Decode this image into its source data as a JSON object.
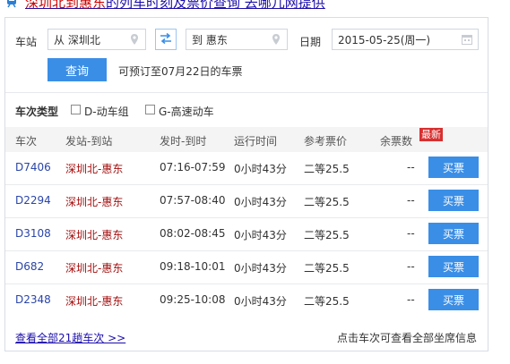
{
  "title": {
    "prefix": "",
    "highlight1": "深圳北到惠东",
    "middle": "的列车时刻及票价查询",
    "suffix": " 去哪儿网提供"
  },
  "search": {
    "station_label": "车站",
    "from_value": "从 深圳北",
    "to_value": "到 惠东",
    "date_label": "日期",
    "date_value": "2015-05-25(周一)",
    "query_button": "查询",
    "note": "可预订至07月22日的车票"
  },
  "filters": {
    "label": "车次类型",
    "options": [
      {
        "label": "D-动车组",
        "checked": false
      },
      {
        "label": "G-高速动车",
        "checked": false
      }
    ]
  },
  "table": {
    "headers": [
      "车次",
      "发站-到站",
      "发时-到时",
      "运行时间",
      "参考票价",
      "余票数"
    ],
    "new_badge": "最新",
    "rows": [
      {
        "train": "D7406",
        "route": "深圳北-惠东",
        "time": "07:16-07:59",
        "duration": "0小时43分",
        "price": "二等25.5",
        "remaining": "--",
        "buy": "买票"
      },
      {
        "train": "D2294",
        "route": "深圳北-惠东",
        "time": "07:57-08:40",
        "duration": "0小时43分",
        "price": "二等25.5",
        "remaining": "--",
        "buy": "买票"
      },
      {
        "train": "D3108",
        "route": "深圳北-惠东",
        "time": "08:02-08:45",
        "duration": "0小时43分",
        "price": "二等25.5",
        "remaining": "--",
        "buy": "买票"
      },
      {
        "train": "D682",
        "route": "深圳北-惠东",
        "time": "09:18-10:01",
        "duration": "0小时43分",
        "price": "二等25.5",
        "remaining": "--",
        "buy": "买票"
      },
      {
        "train": "D2348",
        "route": "深圳北-惠东",
        "time": "09:25-10:08",
        "duration": "0小时43分",
        "price": "二等25.5",
        "remaining": "--",
        "buy": "买票"
      }
    ]
  },
  "footer": {
    "link": "查看全部21趟车次 >>",
    "hint": "点击车次可查看全部坐席信息"
  },
  "colors": {
    "accent": "#3a8ee6",
    "route": "#a30f0f",
    "train": "#2a45a8",
    "badge": "#d82f2f"
  },
  "icons": {
    "title": "train-icon",
    "from": "location-pin-icon",
    "to": "location-pin-icon",
    "swap": "swap-arrows-icon",
    "date": "calendar-icon"
  }
}
